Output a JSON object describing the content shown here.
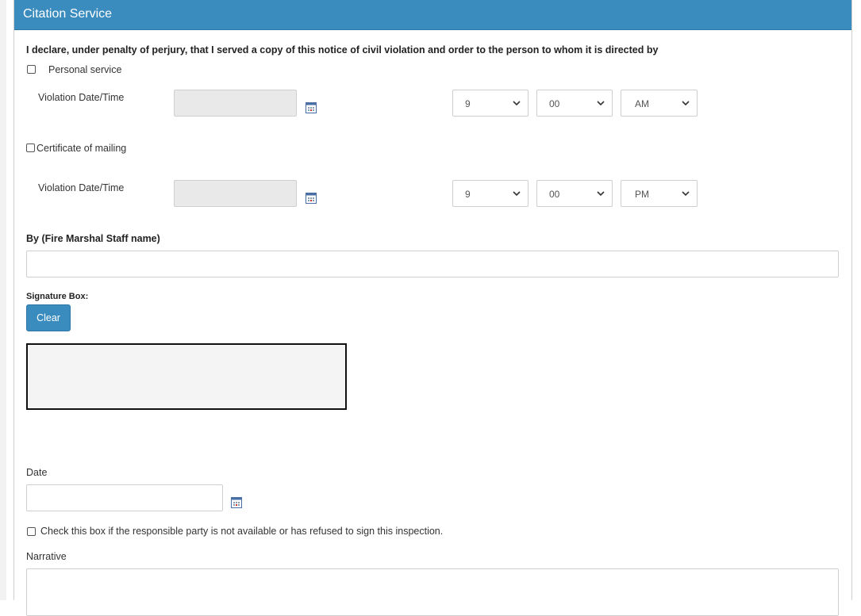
{
  "panel": {
    "title": "Citation Service"
  },
  "declaration": "I declare, under penalty of perjury, that I served a copy of this notice of civil violation and order to the person to whom it is directed by",
  "personal_service": {
    "checkbox_label": "Personal service",
    "checked": false,
    "datetime_label": "Violation Date/Time",
    "date_value": "",
    "hour": "9",
    "minute": "00",
    "ampm": "AM"
  },
  "certificate_mailing": {
    "checkbox_label": "Certificate of mailing",
    "checked": false,
    "datetime_label": "Violation Date/Time",
    "date_value": "",
    "hour": "9",
    "minute": "00",
    "ampm": "PM"
  },
  "staff_name": {
    "label": "By (Fire Marshal Staff name)",
    "value": ""
  },
  "signature": {
    "label": "Signature Box:",
    "clear_label": "Clear"
  },
  "date_field": {
    "label": "Date",
    "value": ""
  },
  "refused_checkbox": {
    "label": "Check this box if the responsible party is not available or has refused to sign this inspection.",
    "checked": false
  },
  "narrative": {
    "label": "Narrative",
    "value": ""
  },
  "colors": {
    "accent": "#3a8cbf",
    "header_text": "#ffffff"
  },
  "icons": {
    "calendar": "calendar-icon",
    "dropdown": "chevron-down-icon"
  }
}
